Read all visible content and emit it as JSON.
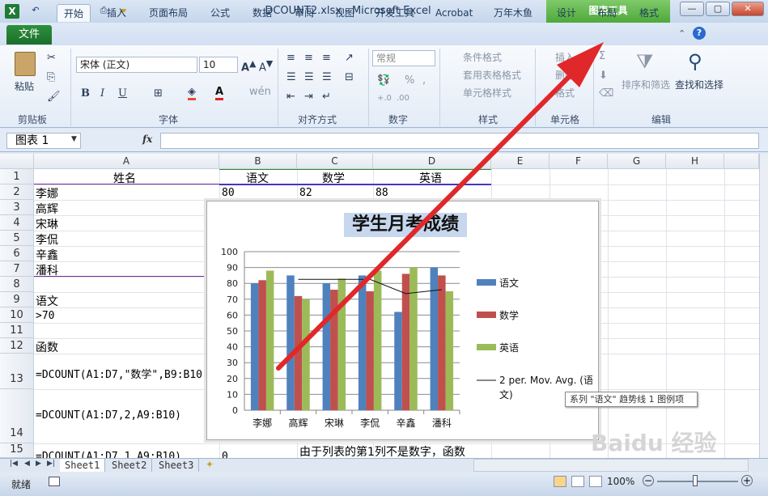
{
  "window": {
    "title": "DCOUNT2.xlsx - Microsoft Excel",
    "contextual_tab_group": "图表工具"
  },
  "tabs": [
    "文件",
    "开始",
    "插入",
    "页面布局",
    "公式",
    "数据",
    "审阅",
    "视图",
    "开发工具",
    "Acrobat",
    "万年木鱼",
    "设计",
    "布局",
    "格式"
  ],
  "ribbon": {
    "clipboard": {
      "paste": "粘贴",
      "group": "剪贴板"
    },
    "font": {
      "name": "宋体 (正文)",
      "size": "10",
      "group": "字体"
    },
    "alignment": {
      "group": "对齐方式"
    },
    "number": {
      "format": "常规",
      "group": "数字"
    },
    "styles": {
      "conditional": "条件格式",
      "table": "套用表格格式",
      "cell": "单元格样式",
      "group": "样式"
    },
    "cells": {
      "insert": "插入",
      "delete": "删除",
      "format": "格式",
      "group": "单元格"
    },
    "editing": {
      "sort": "排序和筛选",
      "find": "查找和选择",
      "group": "编辑"
    }
  },
  "formula_bar": {
    "name_box": "图表 1",
    "fx": "fx",
    "value": ""
  },
  "columns": [
    "A",
    "B",
    "C",
    "D",
    "E",
    "F",
    "G",
    "H"
  ],
  "rows": [
    "1",
    "2",
    "3",
    "4",
    "5",
    "6",
    "7",
    "8",
    "9",
    "10",
    "11",
    "12",
    "13",
    "14",
    "15"
  ],
  "cells": {
    "a1": "姓名",
    "b1": "语文",
    "c1": "数学",
    "d1": "英语",
    "a2": "李娜",
    "b2": "80",
    "c2": "82",
    "d2": "88",
    "a3": "高辉",
    "a4": "宋琳",
    "a5": "李侃",
    "a6": "辛鑫",
    "a7": "潘科",
    "a9": "语文",
    "a10": ">70",
    "a12": "函数",
    "a13": "=DCOUNT(A1:D7,\"数学\",B9:B10)",
    "a14": "=DCOUNT(A1:D7,2,A9:B10)",
    "a15": "=DCOUNT(A1:D7,1,A9:B10)",
    "b15": "0",
    "note": "由于列表的第1列不是数字，函数"
  },
  "chart_data": {
    "type": "bar",
    "title": "学生月考成绩",
    "categories": [
      "李娜",
      "高辉",
      "宋琳",
      "李侃",
      "辛鑫",
      "潘科"
    ],
    "series": [
      {
        "name": "语文",
        "color": "#4f81bd",
        "values": [
          80,
          85,
          80,
          85,
          62,
          90
        ]
      },
      {
        "name": "数学",
        "color": "#c0504d",
        "values": [
          82,
          72,
          76,
          75,
          86,
          85
        ]
      },
      {
        "name": "英语",
        "color": "#9bbb59",
        "values": [
          88,
          70,
          83,
          88,
          90,
          75
        ]
      }
    ],
    "trendline": {
      "name": "2 per. Mov. Avg. (语文)",
      "values": [
        null,
        82.5,
        82.5,
        82.5,
        73.5,
        76
      ]
    },
    "ylim": [
      0,
      100
    ],
    "yticks": [
      "0",
      "10",
      "20",
      "30",
      "40",
      "50",
      "60",
      "70",
      "80",
      "90",
      "100"
    ],
    "legend_position": "right"
  },
  "tooltip": "系列 \"语文\" 趋势线 1 图例项",
  "sheet_tabs": [
    "Sheet1",
    "Sheet2",
    "Sheet3"
  ],
  "status": {
    "ready": "就绪",
    "zoom": "100%"
  },
  "watermark": "Baidu 经验"
}
